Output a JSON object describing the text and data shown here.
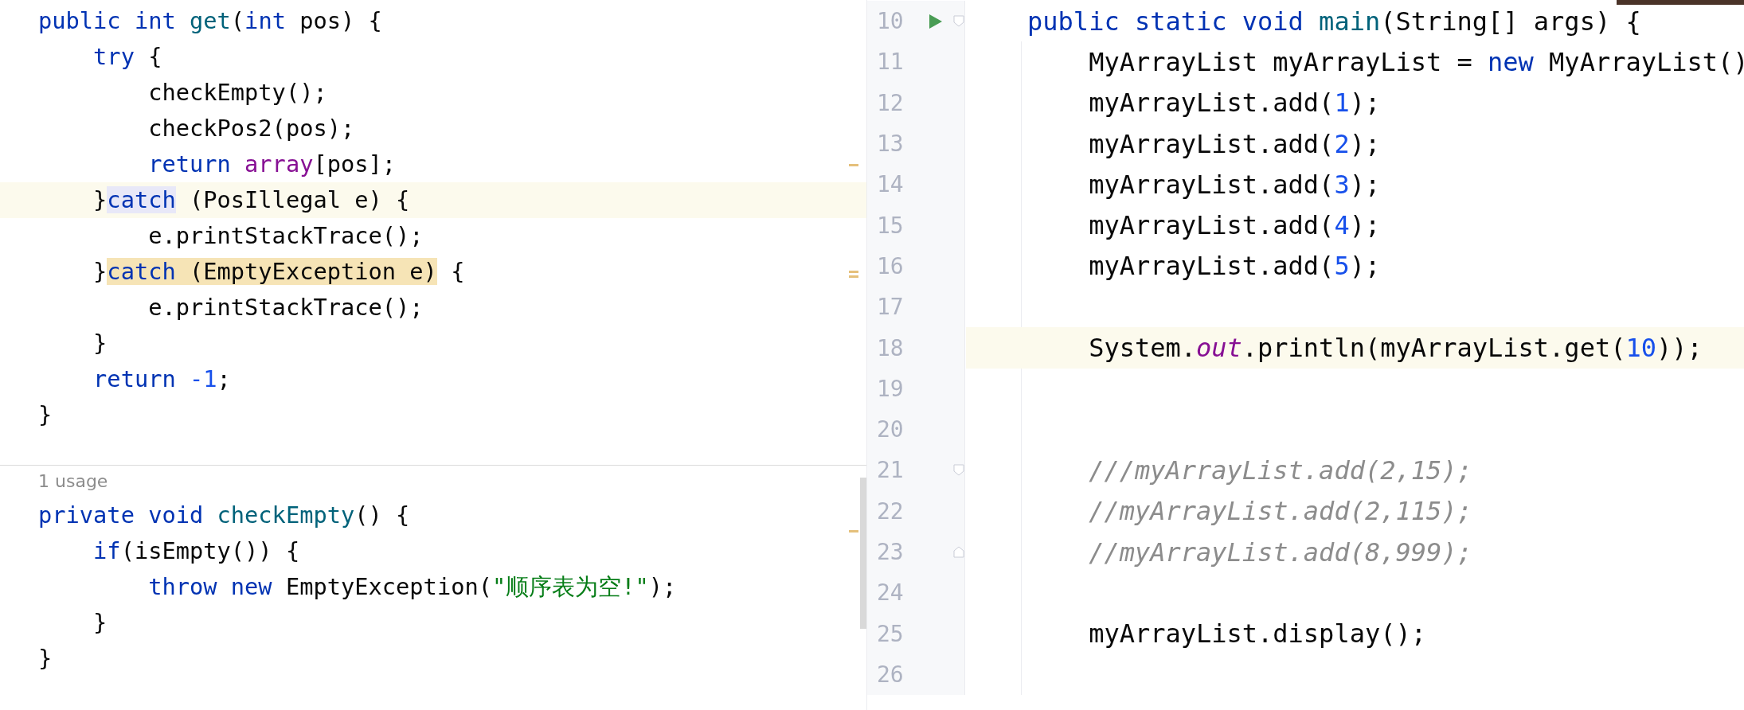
{
  "left_editor": {
    "blocks": [
      {
        "lines": [
          {
            "current": false,
            "tokens": [
              {
                "t": "public int ",
                "kind": "keyword"
              },
              {
                "t": "get",
                "kind": "method"
              },
              {
                "t": "(",
                "kind": "plain"
              },
              {
                "t": "int ",
                "kind": "keyword"
              },
              {
                "t": "pos) {",
                "kind": "plain"
              }
            ]
          },
          {
            "current": false,
            "tokens": [
              {
                "t": "    try ",
                "kind": "keyword"
              },
              {
                "t": "{",
                "kind": "plain"
              }
            ]
          },
          {
            "current": false,
            "tokens": [
              {
                "t": "        checkEmpty();",
                "kind": "plain"
              }
            ]
          },
          {
            "current": false,
            "tokens": [
              {
                "t": "        checkPos2(pos);",
                "kind": "plain"
              }
            ]
          },
          {
            "current": false,
            "tokens": [
              {
                "t": "        return ",
                "kind": "keyword"
              },
              {
                "t": "array",
                "kind": "field"
              },
              {
                "t": "[pos];",
                "kind": "plain"
              }
            ]
          },
          {
            "current": true,
            "tokens": [
              {
                "t": "    }",
                "kind": "plain"
              },
              {
                "t": "catch",
                "kind": "keyword",
                "caret_word_highlight": true
              },
              {
                "t": " (PosIllegal e) {",
                "kind": "plain"
              }
            ]
          },
          {
            "current": false,
            "tokens": [
              {
                "t": "        e.printStackTrace();",
                "kind": "plain"
              }
            ]
          },
          {
            "current": false,
            "tokens": [
              {
                "t": "    }",
                "kind": "plain"
              },
              {
                "t": "catch",
                "kind": "keyword",
                "match_highlight": true
              },
              {
                "t": " (EmptyException e)",
                "kind": "plain",
                "match_highlight": true
              },
              {
                "t": " {",
                "kind": "plain"
              }
            ]
          },
          {
            "current": false,
            "tokens": [
              {
                "t": "        e.printStackTrace();",
                "kind": "plain"
              }
            ]
          },
          {
            "current": false,
            "tokens": [
              {
                "t": "    }",
                "kind": "plain"
              }
            ]
          },
          {
            "current": false,
            "tokens": [
              {
                "t": "    return ",
                "kind": "keyword"
              },
              {
                "t": "-1",
                "kind": "number"
              },
              {
                "t": ";",
                "kind": "plain"
              }
            ]
          },
          {
            "current": false,
            "tokens": [
              {
                "t": "}",
                "kind": "plain"
              }
            ]
          }
        ]
      },
      {
        "usage_hint": "1 usage",
        "lines": [
          {
            "current": false,
            "tokens": [
              {
                "t": "private void ",
                "kind": "keyword"
              },
              {
                "t": "checkEmpty",
                "kind": "method"
              },
              {
                "t": "() {",
                "kind": "plain"
              }
            ]
          },
          {
            "current": false,
            "tokens": [
              {
                "t": "    if",
                "kind": "keyword"
              },
              {
                "t": "(isEmpty()) {",
                "kind": "plain"
              }
            ]
          },
          {
            "current": false,
            "tokens": [
              {
                "t": "        throw new ",
                "kind": "keyword"
              },
              {
                "t": "EmptyException(",
                "kind": "plain"
              },
              {
                "t": "\"顺序表为空!\"",
                "kind": "string"
              },
              {
                "t": ");",
                "kind": "plain"
              }
            ]
          },
          {
            "current": false,
            "tokens": [
              {
                "t": "    }",
                "kind": "plain"
              }
            ]
          },
          {
            "current": false,
            "tokens": [
              {
                "t": "}",
                "kind": "plain"
              }
            ]
          }
        ]
      }
    ]
  },
  "right_editor": {
    "lines": [
      {
        "number": "10",
        "run_icon": true,
        "fold_start": true,
        "current": false,
        "tokens": [
          {
            "t": "    public static void ",
            "kind": "keyword"
          },
          {
            "t": "main",
            "kind": "method"
          },
          {
            "t": "(String[] args) {",
            "kind": "plain"
          }
        ]
      },
      {
        "number": "11",
        "run_icon": false,
        "current": false,
        "tokens": [
          {
            "t": "        MyArrayList myArrayList = ",
            "kind": "plain"
          },
          {
            "t": "new ",
            "kind": "keyword"
          },
          {
            "t": "MyArrayList()",
            "kind": "plain"
          }
        ]
      },
      {
        "number": "12",
        "run_icon": false,
        "current": false,
        "tokens": [
          {
            "t": "        myArrayList.add(",
            "kind": "plain"
          },
          {
            "t": "1",
            "kind": "number"
          },
          {
            "t": ");",
            "kind": "plain"
          }
        ]
      },
      {
        "number": "13",
        "run_icon": false,
        "current": false,
        "tokens": [
          {
            "t": "        myArrayList.add(",
            "kind": "plain"
          },
          {
            "t": "2",
            "kind": "number"
          },
          {
            "t": ");",
            "kind": "plain"
          }
        ]
      },
      {
        "number": "14",
        "run_icon": false,
        "current": false,
        "tokens": [
          {
            "t": "        myArrayList.add(",
            "kind": "plain"
          },
          {
            "t": "3",
            "kind": "number"
          },
          {
            "t": ");",
            "kind": "plain"
          }
        ]
      },
      {
        "number": "15",
        "run_icon": false,
        "current": false,
        "tokens": [
          {
            "t": "        myArrayList.add(",
            "kind": "plain"
          },
          {
            "t": "4",
            "kind": "number"
          },
          {
            "t": ");",
            "kind": "plain"
          }
        ]
      },
      {
        "number": "16",
        "run_icon": false,
        "current": false,
        "tokens": [
          {
            "t": "        myArrayList.add(",
            "kind": "plain"
          },
          {
            "t": "5",
            "kind": "number"
          },
          {
            "t": ");",
            "kind": "plain"
          }
        ]
      },
      {
        "number": "17",
        "run_icon": false,
        "current": false
      },
      {
        "number": "18",
        "run_icon": false,
        "current": true,
        "tokens": [
          {
            "t": "        System.",
            "kind": "plain"
          },
          {
            "t": "out",
            "kind": "static"
          },
          {
            "t": ".println(myArrayList.get(",
            "kind": "plain"
          },
          {
            "t": "10",
            "kind": "number"
          },
          {
            "t": "));",
            "kind": "plain"
          }
        ]
      },
      {
        "number": "19",
        "run_icon": false,
        "current": false
      },
      {
        "number": "20",
        "run_icon": false,
        "current": false
      },
      {
        "number": "21",
        "run_icon": false,
        "fold_start": true,
        "current": false,
        "tokens": [
          {
            "t": "        ///myArrayList.add(2,15);",
            "kind": "comment"
          }
        ]
      },
      {
        "number": "22",
        "run_icon": false,
        "current": false,
        "tokens": [
          {
            "t": "        //myArrayList.add(2,115);",
            "kind": "comment"
          }
        ]
      },
      {
        "number": "23",
        "run_icon": false,
        "fold_end": true,
        "current": false,
        "tokens": [
          {
            "t": "        //myArrayList.add(8,999);",
            "kind": "comment"
          }
        ]
      },
      {
        "number": "24",
        "run_icon": false,
        "current": false
      },
      {
        "number": "25",
        "run_icon": false,
        "current": false,
        "tokens": [
          {
            "t": "        myArrayList.display();",
            "kind": "plain"
          }
        ]
      },
      {
        "number": "26",
        "run_icon": false,
        "current": false
      }
    ]
  }
}
